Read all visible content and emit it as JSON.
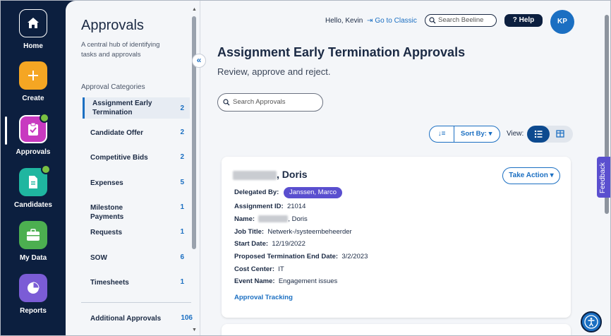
{
  "nav": {
    "items": [
      {
        "label": "Home",
        "icon": "home-icon",
        "color": "#0c1f3f"
      },
      {
        "label": "Create",
        "icon": "plus-icon",
        "color": "#f5a623"
      },
      {
        "label": "Approvals",
        "icon": "clipboard-check-icon",
        "color": "#c83ac0",
        "active": true
      },
      {
        "label": "Candidates",
        "icon": "document-icon",
        "color": "#1fb6a0"
      },
      {
        "label": "My Data",
        "icon": "briefcase-icon",
        "color": "#4caf50"
      },
      {
        "label": "Reports",
        "icon": "pie-chart-icon",
        "color": "#7b5cd6"
      }
    ]
  },
  "categories": {
    "title": "Approvals",
    "description": "A central hub of identifying tasks and approvals",
    "section_label": "Approval Categories",
    "items": [
      {
        "label": "Assignment Early Termination",
        "count": "2"
      },
      {
        "label": "Candidate Offer",
        "count": "2"
      },
      {
        "label": "Competitive Bids",
        "count": "2"
      },
      {
        "label": "Expenses",
        "count": "5"
      },
      {
        "label": "Milestone Payments",
        "count": "1"
      },
      {
        "label": "Requests",
        "count": "1"
      },
      {
        "label": "SOW",
        "count": "6"
      },
      {
        "label": "Timesheets",
        "count": "1"
      }
    ],
    "additional": {
      "label": "Additional Approvals",
      "count": "106"
    }
  },
  "topbar": {
    "greeting": "Hello, Kevin",
    "classic_link": "Go to Classic",
    "search_placeholder": "Search Beeline",
    "help_label": "Help",
    "avatar_initials": "KP"
  },
  "main": {
    "title": "Assignment Early Termination Approvals",
    "subtitle": "Review, approve and reject.",
    "search_placeholder": "Search Approvals",
    "sort_label": "Sort By:",
    "view_label": "View:"
  },
  "card": {
    "name_suffix": ", Doris",
    "take_action": "Take Action",
    "delegated_label": "Delegated By:",
    "delegated_value": "Janssen, Marco",
    "assignment_id_label": "Assignment ID:",
    "assignment_id": "21014",
    "name_label": "Name:",
    "name_value": ", Doris",
    "job_title_label": "Job Title:",
    "job_title": "Netwerk-/systeembeheerder",
    "start_date_label": "Start Date:",
    "start_date": "12/19/2022",
    "proposed_end_label": "Proposed Termination End Date:",
    "proposed_end": "3/2/2023",
    "cost_center_label": "Cost Center:",
    "cost_center": "IT",
    "event_name_label": "Event Name:",
    "event_name": "Engagement issues",
    "tracking_link": "Approval Tracking"
  },
  "feedback_label": "Feedback"
}
